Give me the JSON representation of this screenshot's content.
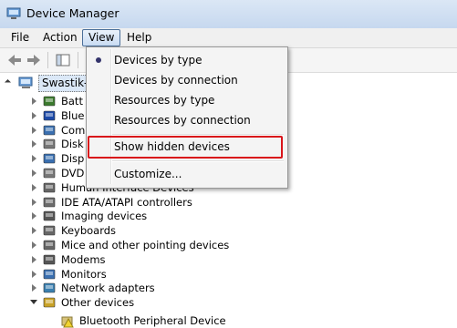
{
  "window": {
    "title": "Device Manager"
  },
  "menubar": {
    "file": "File",
    "action": "Action",
    "view": "View",
    "help": "Help"
  },
  "tree": {
    "root": "Swastik-",
    "devices": [
      {
        "label": "Batt",
        "icon": "battery-icon",
        "color": "#3b7a2d"
      },
      {
        "label": "Blue",
        "icon": "bluetooth-icon",
        "color": "#1c4aa8"
      },
      {
        "label": "Com",
        "icon": "computer-icon",
        "color": "#3a6fb0"
      },
      {
        "label": "Disk",
        "icon": "disk-drive-icon",
        "color": "#777777"
      },
      {
        "label": "Disp",
        "icon": "display-adapter-icon",
        "color": "#3a6fb0"
      },
      {
        "label": "DVD",
        "icon": "dvd-drive-icon",
        "color": "#777777"
      },
      {
        "label": "Human Interface Devices",
        "icon": "hid-icon",
        "color": "#666666"
      },
      {
        "label": "IDE ATA/ATAPI controllers",
        "icon": "ide-controller-icon",
        "color": "#6b6b6b"
      },
      {
        "label": "Imaging devices",
        "icon": "camera-icon",
        "color": "#555555"
      },
      {
        "label": "Keyboards",
        "icon": "keyboard-icon",
        "color": "#666666"
      },
      {
        "label": "Mice and other pointing devices",
        "icon": "mouse-icon",
        "color": "#666666"
      },
      {
        "label": "Modems",
        "icon": "modem-icon",
        "color": "#555555"
      },
      {
        "label": "Monitors",
        "icon": "monitor-icon",
        "color": "#3a6fb0"
      },
      {
        "label": "Network adapters",
        "icon": "network-adapter-icon",
        "color": "#3a7fb0"
      },
      {
        "label": "Other devices",
        "icon": "other-devices-icon",
        "color": "#c9a227"
      }
    ],
    "sub_device": "Bluetooth Peripheral Device"
  },
  "view_menu": {
    "items": [
      {
        "label": "Devices by type",
        "selected": true
      },
      {
        "label": "Devices by connection"
      },
      {
        "label": "Resources by type"
      },
      {
        "label": "Resources by connection"
      },
      {
        "label": "Show hidden devices",
        "highlighted": true
      },
      {
        "label": "Customize..."
      }
    ]
  },
  "colors": {
    "highlight_border": "#d9141a",
    "selected_root_bg": "#dbe8f7"
  }
}
